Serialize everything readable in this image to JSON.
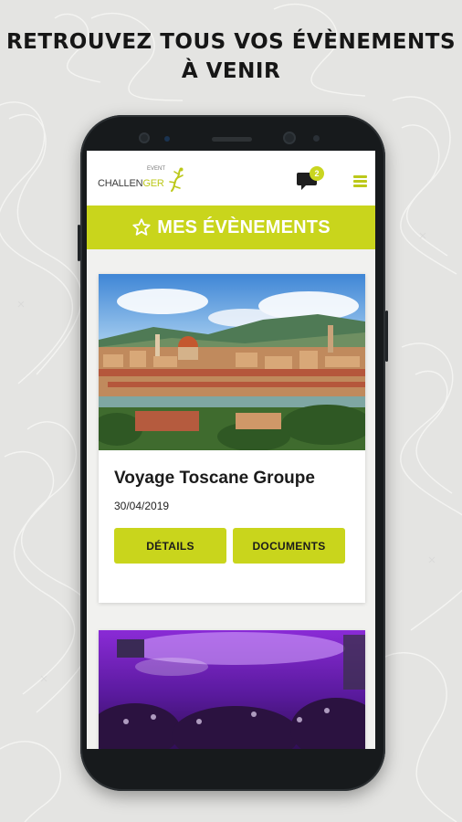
{
  "headline": {
    "line1": "RETROUVEZ TOUS VOS ÉVÈNEMENTS",
    "line2": "À VENIR"
  },
  "app": {
    "logo": {
      "brand_main": "CHALLEN",
      "brand_accent": "GER",
      "tagline": "EVENT"
    },
    "notifications": {
      "count": "2",
      "icon": "chat-bubble-icon"
    },
    "menu_icon": "hamburger-menu-icon",
    "banner": {
      "title": "MES ÉVÈNEMENTS",
      "icon": "star-icon"
    }
  },
  "events": [
    {
      "title": "Voyage Toscane Groupe",
      "date": "30/04/2019",
      "buttons": {
        "details": "DÉTAILS",
        "documents": "DOCUMENTS"
      }
    }
  ],
  "colors": {
    "accent": "#c9d51c",
    "background": "#e4e4e2",
    "phone_body": "#171a1c",
    "text_dark": "#1b1b1b"
  }
}
